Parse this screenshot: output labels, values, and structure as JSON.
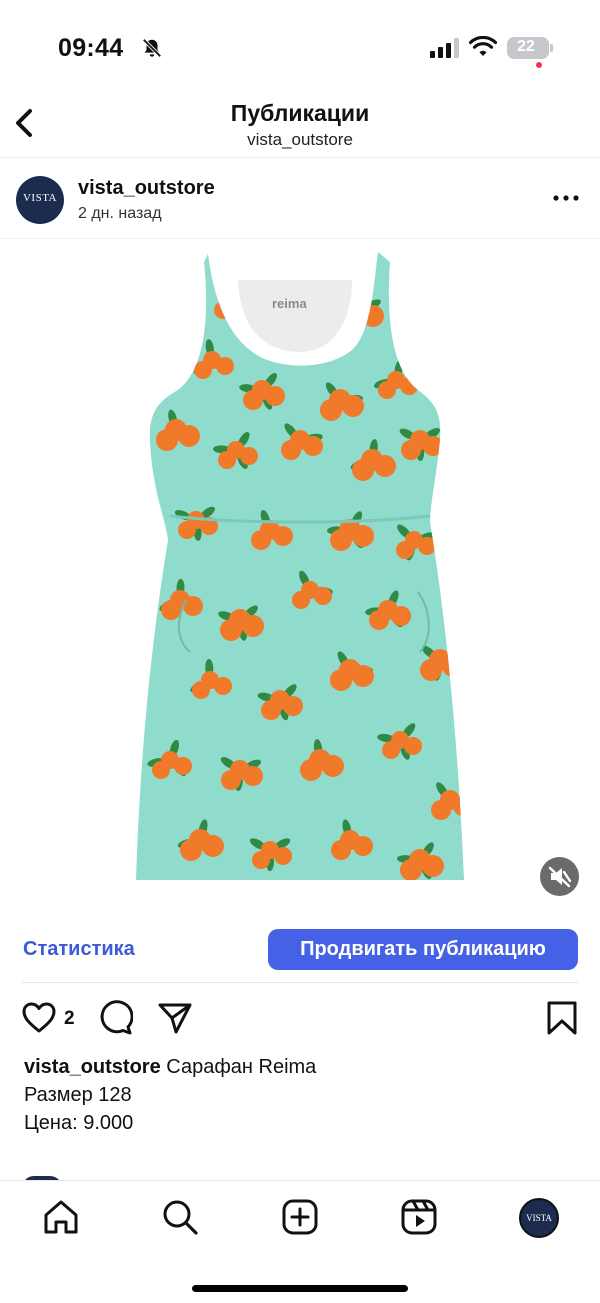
{
  "status_bar": {
    "time": "09:44",
    "battery": "22"
  },
  "nav": {
    "title": "Публикации",
    "subtitle": "vista_outstore"
  },
  "post": {
    "username": "vista_outstore",
    "time_ago": "2 дн. назад",
    "avatar_text": "VISTA",
    "stats_label": "Статистика",
    "promote_label": "Продвигать публикацию",
    "like_count": "2",
    "caption_user": "vista_outstore",
    "caption_lines": [
      "Сарафан Reima",
      "Размер 128",
      "Цена: 9.000"
    ]
  },
  "dress": {
    "brand_label": "reima",
    "base_color": "#8fdccc",
    "fruit_color": "#f07a2a",
    "leaf_color": "#2f8a45"
  },
  "icons": {
    "back": "chevron-left-icon",
    "more": "more-dots-icon",
    "mute": "speaker-muted-icon",
    "like": "heart-icon",
    "comment": "comment-bubble-icon",
    "share": "paper-plane-icon",
    "save": "bookmark-icon",
    "home": "home-icon",
    "search": "search-icon",
    "create": "plus-square-icon",
    "reels": "reels-icon"
  },
  "colors": {
    "accent": "#4562e6",
    "link": "#3d5ad8",
    "notification": "#ff2d55"
  }
}
